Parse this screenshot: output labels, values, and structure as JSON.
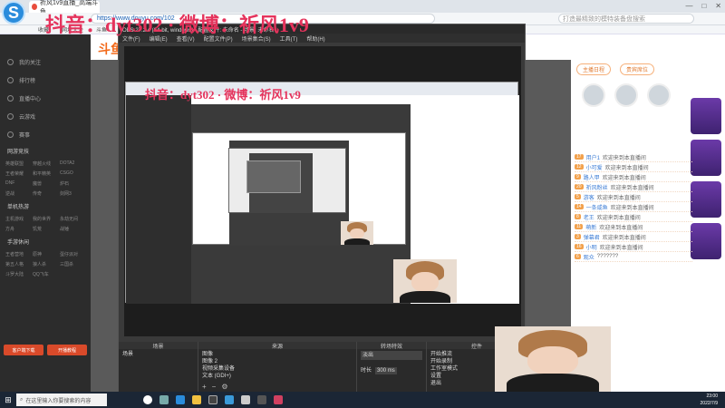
{
  "browser": {
    "tab_title": "祈风1v9直播_高端斗鱼...",
    "address": "https://www.douyu.com/102",
    "search_placeholder": "打造最精致的模特装备盘搜索",
    "bookmarks": [
      "收藏",
      "网址大全",
      "斗鱼"
    ],
    "window_controls": [
      "—",
      "□",
      "✕"
    ]
  },
  "watermark": {
    "main": "抖音：dyt302 · 微博：祈风1v9",
    "nested": "抖音：dyt302 · 微博：祈风1v9"
  },
  "douyu": {
    "logo": "斗鱼",
    "nav_top": [
      "我的关注",
      "排行榜",
      "直播中心",
      "云游戏",
      "赛事"
    ],
    "nav_section_1": "网游竞技",
    "nav_grid_1": [
      "英雄联盟",
      "穿越火线",
      "DOTA2",
      "王者荣耀",
      "和平精英",
      "CSGO",
      "DNF",
      "魔兽",
      "炉石",
      "逆战",
      "传奇",
      "剑网3"
    ],
    "nav_section_2": "单机热游",
    "nav_grid_2": [
      "主机游戏",
      "我的世界",
      "永劫无间",
      "方舟",
      "饥荒",
      "战锤"
    ],
    "nav_section_3": "手游休闲",
    "nav_grid_3": [
      "王者营地",
      "原神",
      "蛋仔派对",
      "第五人格",
      "狼人杀",
      "三国杀",
      "斗罗大陆",
      "QQ飞车"
    ],
    "nav_buttons": [
      "客户端下载",
      "开播教程"
    ]
  },
  "right_panel": {
    "tabs": [
      "主播日程",
      "贵宾席位"
    ],
    "chat": [
      {
        "badge": "17",
        "user": "用户1",
        "text": "欢迎来到本直播间"
      },
      {
        "badge": "12",
        "user": "小可爱",
        "text": "欢迎来到本直播间"
      },
      {
        "badge": "9",
        "user": "路人甲",
        "text": "欢迎来到本直播间"
      },
      {
        "badge": "20",
        "user": "祈风粉丝",
        "text": "欢迎来到本直播间"
      },
      {
        "badge": "5",
        "user": "游客",
        "text": "欢迎来到本直播间"
      },
      {
        "badge": "14",
        "user": "一条咸鱼",
        "text": "欢迎来到本直播间"
      },
      {
        "badge": "8",
        "user": "老王",
        "text": "欢迎来到本直播间"
      },
      {
        "badge": "11",
        "user": "萌新",
        "text": "欢迎来到本直播间"
      },
      {
        "badge": "3",
        "user": "弹幕君",
        "text": "欢迎来到本直播间"
      },
      {
        "badge": "16",
        "user": "小明",
        "text": "欢迎来到本直播间"
      },
      {
        "badge": "6",
        "user": "观众",
        "text": "???????"
      }
    ]
  },
  "obs": {
    "title": "OBS 27.2.4 (64-bit, windows) - 配置文件: 未命名 - 场景: 未命名",
    "menu": [
      "文件(F)",
      "编辑(E)",
      "查看(V)",
      "配置文件(P)",
      "场景集合(S)",
      "工具(T)",
      "帮助(H)"
    ],
    "docks": {
      "scenes": {
        "title": "场景",
        "items": [
          "场景"
        ]
      },
      "sources": {
        "title": "来源",
        "items": [
          "图像",
          "图像 2",
          "视频采集设备",
          "文本 (GDI+)"
        ]
      },
      "transitions": {
        "title": "转场特效",
        "value": "淡出",
        "duration_label": "时长",
        "duration": "300 ms"
      },
      "controls": {
        "title": "控件",
        "items": [
          "开始推流",
          "开始录制",
          "工作室模式",
          "设置",
          "退出"
        ]
      }
    }
  },
  "taskbar": {
    "search": "在这里输入你要搜索的内容",
    "time": "23:00",
    "date": "2022/7/9"
  }
}
